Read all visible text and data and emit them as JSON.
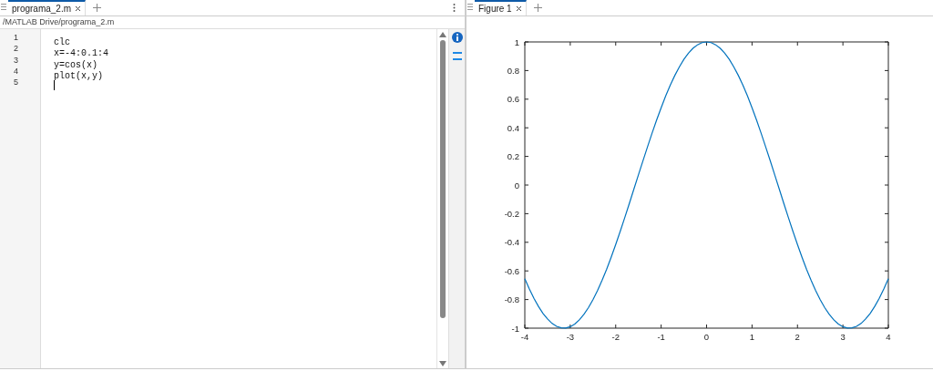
{
  "editor": {
    "tabs": [
      {
        "label": "programa_2.m",
        "selected": true
      }
    ],
    "path": "/MATLAB Drive/programa_2.m",
    "lines": [
      {
        "number": "1",
        "code": "clc",
        "cursor": false
      },
      {
        "number": "2",
        "code": "x=-4:0.1:4",
        "cursor": false
      },
      {
        "number": "3",
        "code": "y=cos(x)",
        "cursor": false
      },
      {
        "number": "4",
        "code": "plot(x,y)",
        "cursor": false
      },
      {
        "number": "5",
        "cursor": true
      }
    ]
  },
  "figure": {
    "tabs": [
      {
        "label": "Figure 1",
        "selected": true
      }
    ],
    "chart_data": {
      "type": "line",
      "xlim": [
        -4,
        4
      ],
      "ylim": [
        -1,
        1
      ],
      "xticks": [
        -4,
        -3,
        -2,
        -1,
        0,
        1,
        2,
        3,
        4
      ],
      "yticks": [
        -1,
        -0.8,
        -0.6,
        -0.4,
        -0.2,
        0,
        0.2,
        0.4,
        0.6,
        0.8,
        1
      ],
      "x": [
        -4,
        -3.9,
        -3.8,
        -3.7,
        -3.6,
        -3.5,
        -3.4,
        -3.3,
        -3.2,
        -3.1,
        -3,
        -2.9,
        -2.8,
        -2.7,
        -2.6,
        -2.5,
        -2.4,
        -2.3,
        -2.2,
        -2.1,
        -2,
        -1.9,
        -1.8,
        -1.7,
        -1.6,
        -1.5,
        -1.4,
        -1.3,
        -1.2,
        -1.1,
        -1,
        -0.9,
        -0.8,
        -0.7,
        -0.6,
        -0.5,
        -0.4,
        -0.3,
        -0.2,
        -0.1,
        0,
        0.1,
        0.2,
        0.3,
        0.4,
        0.5,
        0.6,
        0.7,
        0.8,
        0.9,
        1,
        1.1,
        1.2,
        1.3,
        1.4,
        1.5,
        1.6,
        1.7,
        1.8,
        1.9,
        2,
        2.1,
        2.2,
        2.3,
        2.4,
        2.5,
        2.6,
        2.7,
        2.8,
        2.9,
        3,
        3.1,
        3.2,
        3.3,
        3.4,
        3.5,
        3.6,
        3.7,
        3.8,
        3.9,
        4
      ],
      "series": [
        {
          "color": "#0072bd",
          "values": [
            -0.654,
            -0.726,
            -0.791,
            -0.848,
            -0.897,
            -0.936,
            -0.967,
            -0.987,
            -0.998,
            -0.999,
            -0.99,
            -0.971,
            -0.942,
            -0.904,
            -0.857,
            -0.801,
            -0.737,
            -0.666,
            -0.589,
            -0.505,
            -0.416,
            -0.323,
            -0.227,
            -0.129,
            -0.029,
            0.071,
            0.17,
            0.267,
            0.362,
            0.454,
            0.54,
            0.622,
            0.697,
            0.765,
            0.825,
            0.878,
            0.921,
            0.955,
            0.98,
            0.995,
            1,
            0.995,
            0.98,
            0.955,
            0.921,
            0.878,
            0.825,
            0.765,
            0.697,
            0.622,
            0.54,
            0.454,
            0.362,
            0.267,
            0.17,
            0.071,
            -0.029,
            -0.129,
            -0.227,
            -0.323,
            -0.416,
            -0.505,
            -0.589,
            -0.666,
            -0.737,
            -0.801,
            -0.857,
            -0.904,
            -0.942,
            -0.971,
            -0.99,
            -0.999,
            -0.998,
            -0.987,
            -0.967,
            -0.936,
            -0.897,
            -0.848,
            -0.791,
            -0.726,
            -0.654
          ]
        }
      ]
    }
  }
}
